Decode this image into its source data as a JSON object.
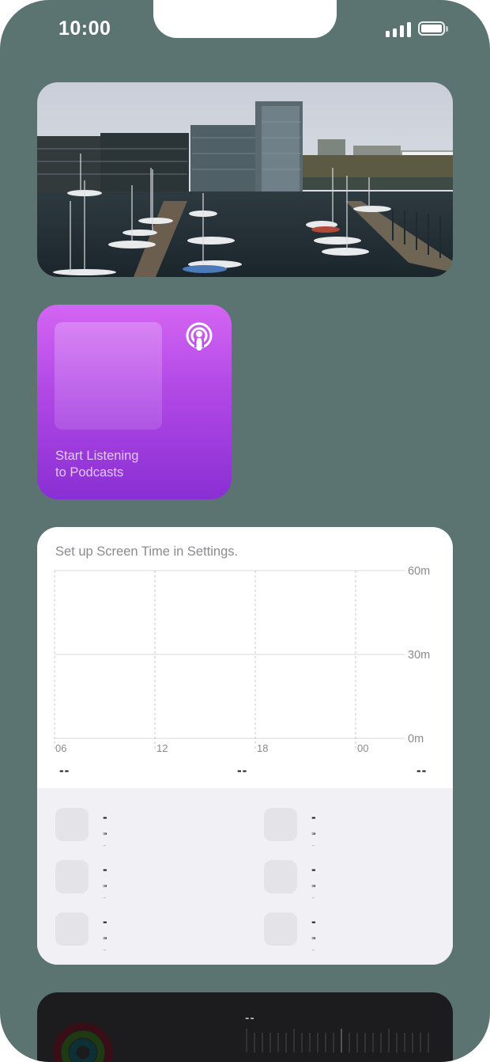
{
  "status_bar": {
    "time": "10:00"
  },
  "photo_widget": {
    "subject": "harbor-marina-photo"
  },
  "podcasts_widget": {
    "prompt_line1": "Start Listening",
    "prompt_line2": "to Podcasts",
    "icon": "podcasts-icon",
    "colors": {
      "top": "#d465f3",
      "bottom": "#8a2fd3"
    }
  },
  "screentime_widget": {
    "title": "Set up Screen Time in Settings.",
    "y_labels": [
      "60m",
      "30m",
      "0m"
    ],
    "x_labels": [
      "06",
      "12",
      "18",
      "00"
    ],
    "summary": [
      "--",
      "--",
      "--"
    ],
    "apps": [
      {
        "name": "--",
        "time": "--"
      },
      {
        "name": "--",
        "time": "--"
      },
      {
        "name": "--",
        "time": "--"
      },
      {
        "name": "--",
        "time": "--"
      },
      {
        "name": "--",
        "time": "--"
      },
      {
        "name": "--",
        "time": "--"
      }
    ]
  },
  "activity_widget": {
    "value": "--",
    "ring_colors": [
      "#e5134d",
      "#5ee32b",
      "#1cc6d8"
    ]
  }
}
